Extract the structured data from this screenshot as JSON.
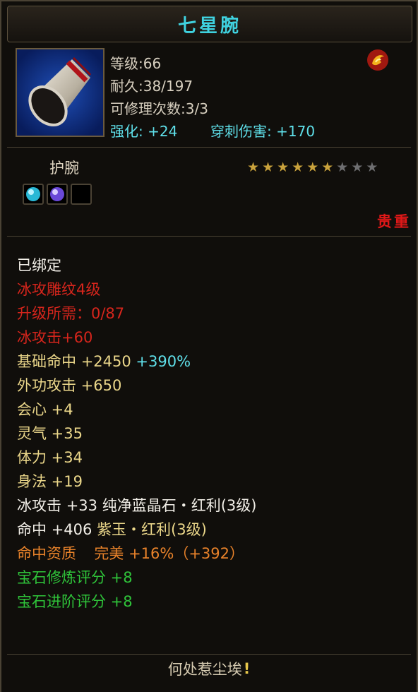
{
  "title": "七星腕",
  "stats": {
    "level": "等级:66",
    "durability": "耐久:38/197",
    "repair": "可修理次数:3/3",
    "enhance_label": "强化:",
    "enhance_value": "+24",
    "pierce_label": "穿刺伤害:",
    "pierce_value": "+170"
  },
  "item_type": "护腕",
  "stars": {
    "filled": 6,
    "total": 9
  },
  "sockets": [
    {
      "name": "cyan-gem-icon",
      "color": "#29b8d6"
    },
    {
      "name": "purple-gem-icon",
      "color": "#6a48d8"
    },
    {
      "name": "empty-socket-icon",
      "color": "#000000"
    }
  ],
  "rarity": "贵重",
  "attributes": {
    "bound": "已绑定",
    "ice_level": "冰攻雕纹4级",
    "upgrade_need": "升级所需：0/87",
    "ice_attack": "冰攻击+60",
    "base_hit_label": "基础命中",
    "base_hit_value": "+2450",
    "base_hit_pct": "+390%",
    "outer_attack": "外功攻击 +650",
    "crit": "会心 +4",
    "spirit": "灵气 +35",
    "stamina": "体力 +34",
    "agility": "身法 +19",
    "ice_attack2_label": "冰攻击",
    "ice_attack2_value": "+33",
    "gem1": "纯净蓝晶石・红利(3级)",
    "hit_label": "命中",
    "hit_value": "+406",
    "gem2": "紫玉・红利(3级)",
    "hit_quality_label": "命中资质",
    "hit_quality_grade": "完美",
    "hit_quality_value": "+16%（+392）",
    "gem_refine_score": "宝石修炼评分 +8",
    "gem_advance_score": "宝石进阶评分 +8"
  },
  "footer": "何处惹尘埃",
  "colors": {
    "title": "#3fd2e0",
    "cyan": "#5fe0ea",
    "red": "#d6251c",
    "yellow": "#ebd78a",
    "orange": "#e8822a",
    "green": "#2fc43a"
  }
}
